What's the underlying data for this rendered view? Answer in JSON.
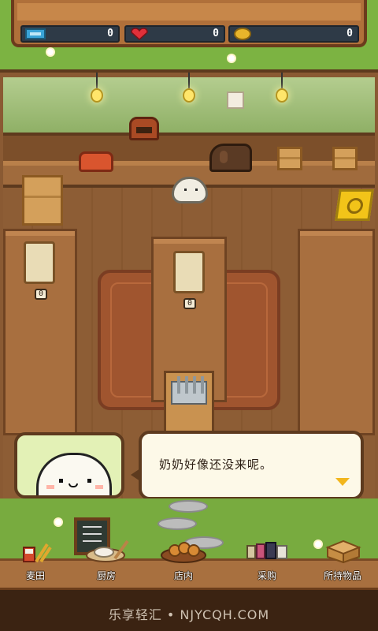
{
  "status_bar": {
    "tickets": {
      "icon": "ticket-icon",
      "value": "0"
    },
    "hearts": {
      "icon": "heart-icon",
      "value": "0"
    },
    "coins": {
      "icon": "coin-icon",
      "value": "0"
    }
  },
  "shop": {
    "seat_counts": [
      "0",
      "0"
    ]
  },
  "dialog": {
    "speaker_icon": "seal-portrait",
    "text": "奶奶好像还没来呢。",
    "advance_icon": "triangle-down-icon"
  },
  "nav": {
    "items": [
      {
        "label": "麦田",
        "icon": "wheat-field-icon"
      },
      {
        "label": "厨房",
        "icon": "kitchen-icon"
      },
      {
        "label": "店内",
        "icon": "bread-tray-icon"
      },
      {
        "label": "采购",
        "icon": "shopping-icon"
      },
      {
        "label": "所持物品",
        "icon": "box-icon"
      }
    ]
  },
  "footer": {
    "watermark": "乐享轻汇 • NJYCQH.COM"
  },
  "colors": {
    "accent": "#f2b61d",
    "wood": "#a8703f",
    "grass": "#7cb342"
  }
}
